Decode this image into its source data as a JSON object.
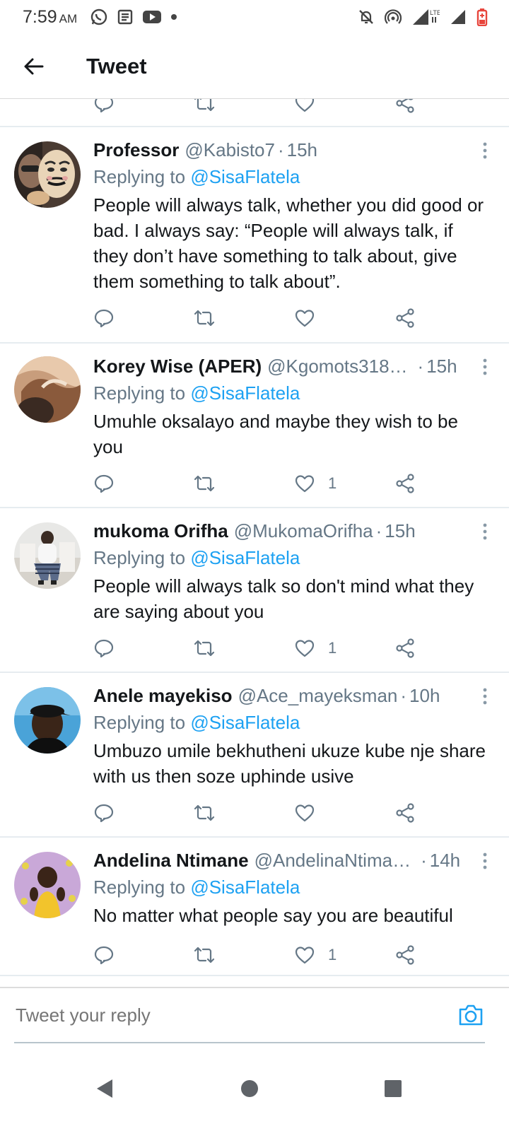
{
  "status_bar": {
    "time": "7:59",
    "ampm": "AM",
    "left_icons": [
      "whatsapp-icon",
      "news-icon",
      "youtube-icon",
      "dot-icon"
    ],
    "right_icons": [
      "muted-bell-icon",
      "hotspot-icon",
      "lte-signal-icon",
      "signal-icon",
      "battery-low-icon"
    ],
    "battery_color": "#e8453c"
  },
  "header": {
    "title": "Tweet",
    "back_icon": "arrow-left-icon"
  },
  "colors": {
    "link": "#1da1f2",
    "secondary_text": "#657786",
    "divider": "#e6ecf0"
  },
  "tweets": [
    {
      "name": "Professor",
      "handle": "@Kabisto7",
      "time": "15h",
      "replying_prefix": "Replying to",
      "replying_to": "@SisaFlatela",
      "text": "People will always talk, whether you did good or bad. I always say: “People will always talk, if they don’t have something to talk about, give them something to talk about”.",
      "likes": "",
      "avatar": "masked-man-avatar"
    },
    {
      "name": "Korey Wise (APER)",
      "handle": "@Kgomots318…",
      "time": "15h",
      "replying_prefix": "Replying to",
      "replying_to": "@SisaFlatela",
      "text": "Umuhle oksalayo and maybe they wish to be you",
      "likes": "1",
      "avatar": "sepia-photo-avatar"
    },
    {
      "name": "mukoma Orifha",
      "handle": "@MukomaOrifha",
      "time": "15h",
      "replying_prefix": "Replying to",
      "replying_to": "@SisaFlatela",
      "text": "People will always talk so don't mind what they are saying about you",
      "likes": "1",
      "avatar": "seated-person-avatar"
    },
    {
      "name": "Anele mayekiso",
      "handle": "@Ace_mayeksman",
      "time": "10h",
      "replying_prefix": "Replying to",
      "replying_to": "@SisaFlatela",
      "text": "Umbuzo umile bekhutheni ukuze kube nje share with us then soze uphinde usive",
      "likes": "",
      "avatar": "cap-man-avatar"
    },
    {
      "name": "Andelina Ntimane",
      "handle": "@AndelinaNtima…",
      "time": "14h",
      "replying_prefix": "Replying to",
      "replying_to": "@SisaFlatela",
      "text": "No matter what people say you are beautiful",
      "likes": "1",
      "avatar": "baby-photo-avatar"
    }
  ],
  "composer": {
    "placeholder": "Tweet your reply",
    "camera_icon": "camera-icon"
  },
  "nav_bar": {
    "buttons": [
      "back-triangle-icon",
      "home-circle-icon",
      "recents-square-icon"
    ]
  }
}
